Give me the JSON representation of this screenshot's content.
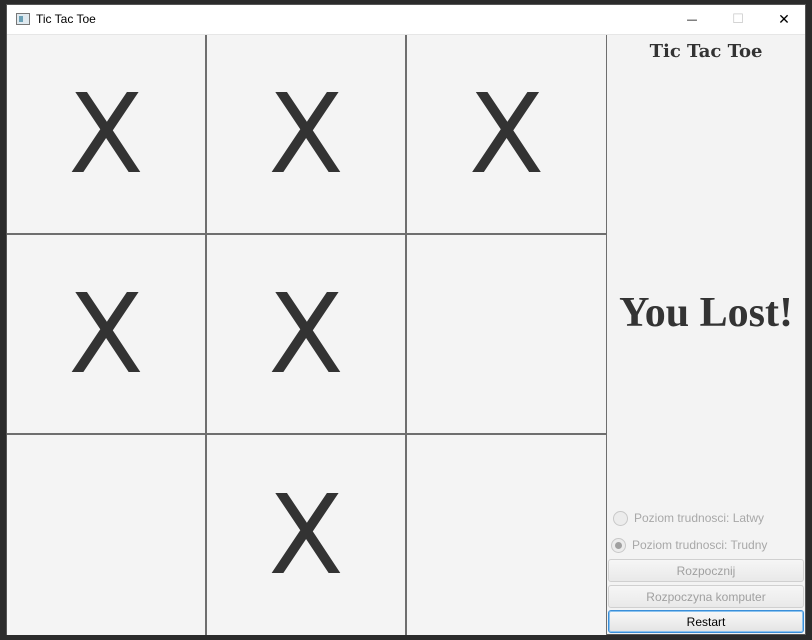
{
  "window": {
    "title": "Tic Tac Toe",
    "minimize_glyph": "—",
    "maximize_glyph": "☐",
    "close_glyph": "✕"
  },
  "board": {
    "cells": [
      [
        "X",
        "X",
        "X"
      ],
      [
        "X",
        "X",
        ""
      ],
      [
        "",
        "X",
        ""
      ]
    ]
  },
  "side": {
    "title": "Tic Tac Toe",
    "result": "You Lost!",
    "radio_easy": {
      "label": "Poziom trudnosci: Latwy",
      "checked": false
    },
    "radio_hard": {
      "label": "Poziom trudnosci: Trudny",
      "checked": true
    },
    "start_button": "Rozpocznij",
    "start_computer_button": "Rozpoczyna komputer",
    "restart_button": "Restart"
  }
}
